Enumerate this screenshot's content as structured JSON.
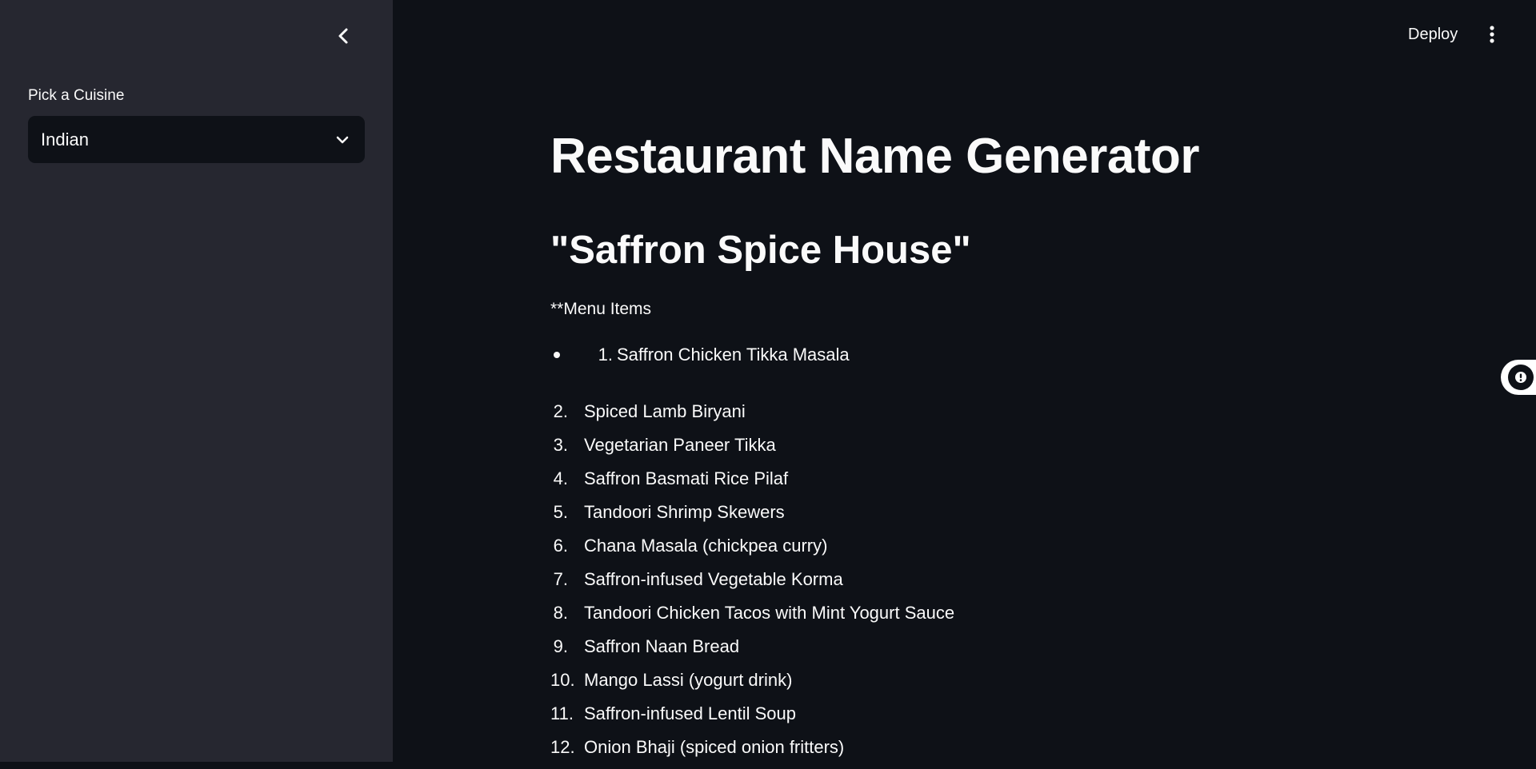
{
  "sidebar": {
    "select_label": "Pick a Cuisine",
    "select_value": "Indian"
  },
  "topbar": {
    "deploy_label": "Deploy"
  },
  "main": {
    "title": "Restaurant Name Generator",
    "restaurant_name": "\"Saffron Spice House\"",
    "menu_heading": "**Menu Items",
    "bullet_item": {
      "number": "1.",
      "text": "Saffron Chicken Tikka Masala"
    },
    "items": [
      {
        "number": "2.",
        "text": "Spiced Lamb Biryani"
      },
      {
        "number": "3.",
        "text": "Vegetarian Paneer Tikka"
      },
      {
        "number": "4.",
        "text": "Saffron Basmati Rice Pilaf"
      },
      {
        "number": "5.",
        "text": "Tandoori Shrimp Skewers"
      },
      {
        "number": "6.",
        "text": "Chana Masala (chickpea curry)"
      },
      {
        "number": "7.",
        "text": "Saffron-infused Vegetable Korma"
      },
      {
        "number": "8.",
        "text": "Tandoori Chicken Tacos with Mint Yogurt Sauce"
      },
      {
        "number": "9.",
        "text": "Saffron Naan Bread"
      },
      {
        "number": "10.",
        "text": "Mango Lassi (yogurt drink)"
      },
      {
        "number": "11.",
        "text": "Saffron-infused Lentil Soup"
      },
      {
        "number": "12.",
        "text": "Onion Bhaji (spiced onion fritters)"
      }
    ]
  },
  "icons": {
    "collapse": "chevron-left-icon",
    "select": "chevron-down-icon",
    "menu": "vertical-ellipsis-icon",
    "widget": "chat-widget-icon"
  },
  "colors": {
    "main_bg": "#0e1117",
    "sidebar_bg": "#262730",
    "text": "#fafafa"
  }
}
